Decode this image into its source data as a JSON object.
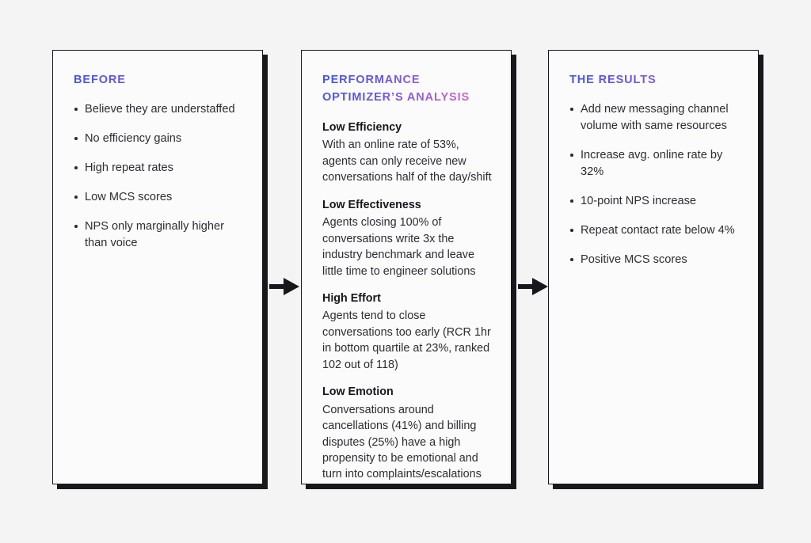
{
  "theme": {
    "background": "#f4f4f5",
    "card_background": "#fbfbfb",
    "card_border": "#17171c",
    "shadow": "#17171c",
    "text": "#2d2d33",
    "gradient_start": "#4355e8",
    "gradient_end": "#f266c4"
  },
  "cards": [
    {
      "title": "BEFORE",
      "bullets": [
        "Believe they are understaffed",
        "No efficiency gains",
        "High repeat rates",
        "Low MCS scores",
        "NPS only marginally higher than voice"
      ]
    },
    {
      "title": "PERFORMANCE\nOPTIMIZER’S ANALYSIS",
      "sections": [
        {
          "heading": "Low Efficiency",
          "body": "With an online rate of 53%, agents can only receive new conversations half of the day/shift"
        },
        {
          "heading": "Low Effectiveness",
          "body": "Agents closing 100% of conversations write 3x the industry benchmark and leave little time to engineer solutions"
        },
        {
          "heading": "High Effort",
          "body": "Agents tend to close conversations too early (RCR 1hr in bottom quartile at 23%, ranked 102 out of 118)"
        },
        {
          "heading": "Low Emotion",
          "body": "Conversations around cancellations (41%) and billing disputes (25%) have a high propensity to be emotional and turn into complaints/escalations"
        }
      ]
    },
    {
      "title": "THE RESULTS",
      "bullets": [
        "Add new messaging channel volume with same resources",
        "Increase avg. online rate by 32%",
        "10-point NPS increase",
        "Repeat contact rate below 4%",
        "Positive MCS scores"
      ]
    }
  ],
  "connectors": [
    {
      "icon": "arrow-right-icon"
    },
    {
      "icon": "arrow-right-icon"
    }
  ]
}
